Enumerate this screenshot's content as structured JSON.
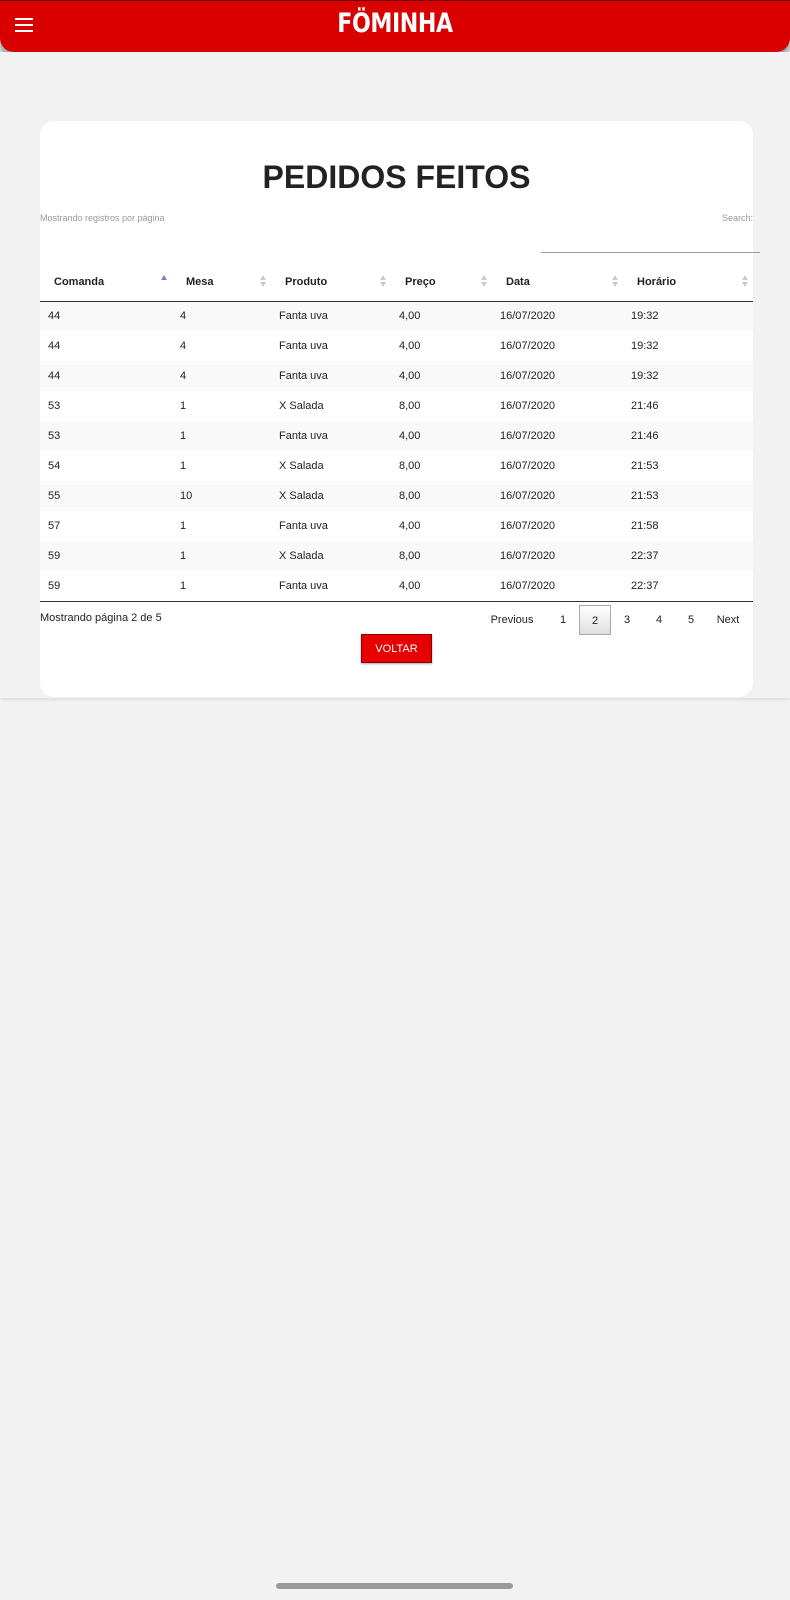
{
  "header": {
    "logo_text": "FÖMINHA",
    "menu_icon": "hamburger-menu-icon",
    "brand_color": "#d90000"
  },
  "page": {
    "title": "PEDIDOS FEITOS",
    "showing_label": "Mostrando registros por página",
    "search_label": "Search:",
    "search_value": ""
  },
  "table": {
    "columns": [
      "Comanda",
      "Mesa",
      "Produto",
      "Preço",
      "Data",
      "Horário"
    ],
    "sorted_column": "Comanda",
    "sort_direction": "ascending",
    "rows": [
      [
        "44",
        "4",
        "Fanta uva",
        "4,00",
        "16/07/2020",
        "19:32"
      ],
      [
        "44",
        "4",
        "Fanta uva",
        "4,00",
        "16/07/2020",
        "19:32"
      ],
      [
        "44",
        "4",
        "Fanta uva",
        "4,00",
        "16/07/2020",
        "19:32"
      ],
      [
        "53",
        "1",
        "X Salada",
        "8,00",
        "16/07/2020",
        "21:46"
      ],
      [
        "53",
        "1",
        "Fanta uva",
        "4,00",
        "16/07/2020",
        "21:46"
      ],
      [
        "54",
        "1",
        "X Salada",
        "8,00",
        "16/07/2020",
        "21:53"
      ],
      [
        "55",
        "10",
        "X Salada",
        "8,00",
        "16/07/2020",
        "21:53"
      ],
      [
        "57",
        "1",
        "Fanta uva",
        "4,00",
        "16/07/2020",
        "21:58"
      ],
      [
        "59",
        "1",
        "X Salada",
        "8,00",
        "16/07/2020",
        "22:37"
      ],
      [
        "59",
        "1",
        "Fanta uva",
        "4,00",
        "16/07/2020",
        "22:37"
      ]
    ]
  },
  "pagination": {
    "info": "Mostrando página 2 de 5",
    "previous": "Previous",
    "next": "Next",
    "pages": [
      "1",
      "2",
      "3",
      "4",
      "5"
    ],
    "current": "2"
  },
  "actions": {
    "back_label": "VOLTAR",
    "back_color": "#e60000"
  }
}
